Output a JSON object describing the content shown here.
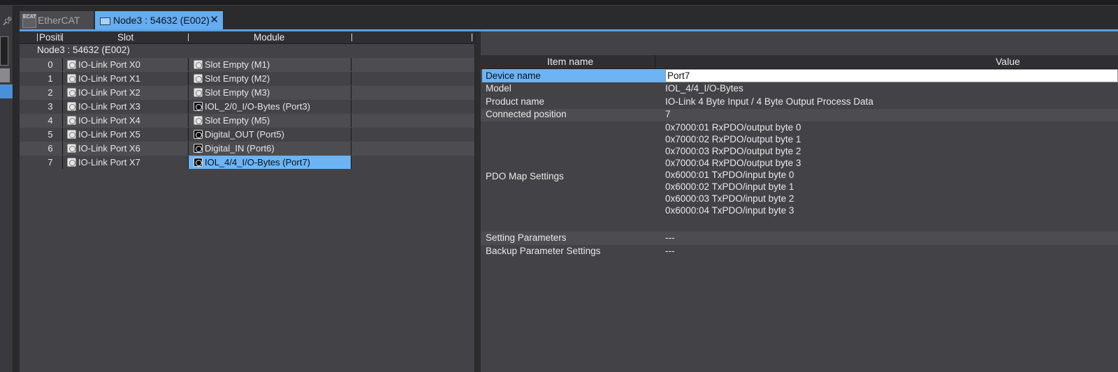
{
  "tabs": [
    {
      "label": "EtherCAT",
      "icon": "ecat-icon",
      "active": false
    },
    {
      "label": "Node3 : 54632 (E002)",
      "icon": "node-icon",
      "active": true,
      "close": "✕"
    }
  ],
  "ecat_icon_text": "ECAT",
  "slot_table": {
    "headers": {
      "position": "Positi",
      "slot": "Slot",
      "module": "Module"
    },
    "node_label": "Node3 : 54632 (E002)",
    "rows": [
      {
        "pos": "0",
        "slot": "IO-Link Port X0",
        "module": "Slot Empty (M1)",
        "module_icon": "empty-slot-icon"
      },
      {
        "pos": "1",
        "slot": "IO-Link Port X1",
        "module": "Slot Empty (M2)",
        "module_icon": "empty-slot-icon"
      },
      {
        "pos": "2",
        "slot": "IO-Link Port X2",
        "module": "Slot Empty (M3)",
        "module_icon": "empty-slot-icon"
      },
      {
        "pos": "3",
        "slot": "IO-Link Port X3",
        "module": "IOL_2/0_I/O-Bytes (Port3)",
        "module_icon": "device-icon"
      },
      {
        "pos": "4",
        "slot": "IO-Link Port X4",
        "module": "Slot Empty (M5)",
        "module_icon": "empty-slot-icon"
      },
      {
        "pos": "5",
        "slot": "IO-Link Port X5",
        "module": "Digital_OUT (Port5)",
        "module_icon": "device-icon"
      },
      {
        "pos": "6",
        "slot": "IO-Link Port X6",
        "module": "Digital_IN (Port6)",
        "module_icon": "device-icon"
      },
      {
        "pos": "7",
        "slot": "IO-Link Port X7",
        "module": "IOL_4/4_I/O-Bytes (Port7)",
        "module_icon": "device-icon",
        "selected": true
      }
    ]
  },
  "properties": {
    "headers": {
      "item_name": "Item name",
      "value": "Value"
    },
    "device_name": {
      "label": "Device name",
      "value": "Port7"
    },
    "model": {
      "label": "Model",
      "value": "IOL_4/4_I/O-Bytes"
    },
    "product_name": {
      "label": "Product name",
      "value": "IO-Link 4 Byte Input / 4 Byte Output Process Data"
    },
    "connected_position": {
      "label": "Connected position",
      "value": "7"
    },
    "pdo_map": {
      "label": "PDO Map Settings",
      "values": [
        "0x7000:01 RxPDO/output byte 0",
        "0x7000:02 RxPDO/output byte 1",
        "0x7000:03 RxPDO/output byte 2",
        "0x7000:04 RxPDO/output byte 3",
        "0x6000:01 TxPDO/input byte 0",
        "0x6000:02 TxPDO/input byte 1",
        "0x6000:03 TxPDO/input byte 2",
        "0x6000:04 TxPDO/input byte 3"
      ]
    },
    "setting_parameters": {
      "label": "Setting Parameters",
      "value": "---"
    },
    "backup_parameter_settings": {
      "label": "Backup Parameter Settings",
      "value": "---"
    }
  },
  "colors": {
    "selection": "#6cb4f4",
    "active_tab": "#65acf0",
    "panel_bg": "#434347",
    "row_alt": "#4d4d51"
  },
  "pin_icon": "pin-icon"
}
